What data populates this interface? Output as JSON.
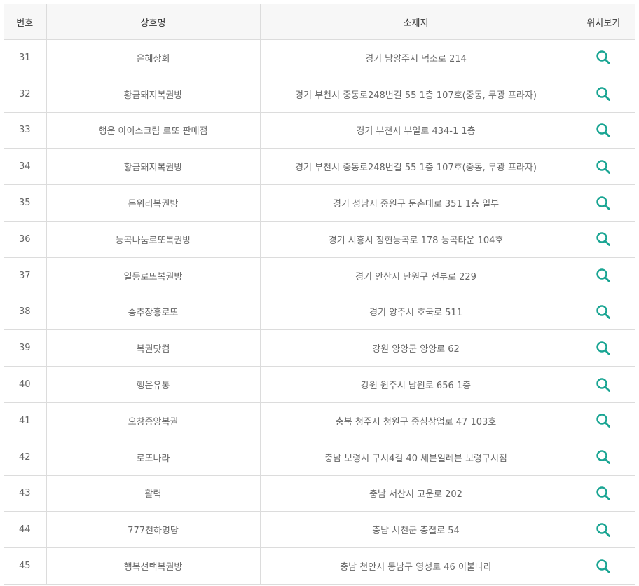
{
  "headers": [
    "번호",
    "상호명",
    "소재지",
    "위치보기"
  ],
  "accent_color": "#1aa593",
  "rows": [
    {
      "num": "31",
      "name": "은혜상회",
      "address": "경기 남양주시 덕소로 214"
    },
    {
      "num": "32",
      "name": "황금돼지복권방",
      "address": "경기 부천시 중동로248번길 55 1층 107호(중동, 무광 프라자)"
    },
    {
      "num": "33",
      "name": "행운 아이스크림 로또 판매점",
      "address": "경기 부천시 부일로 434-1 1층"
    },
    {
      "num": "34",
      "name": "황금돼지복권방",
      "address": "경기 부천시 중동로248번길 55 1층 107호(중동, 무광 프라자)"
    },
    {
      "num": "35",
      "name": "돈워리복권방",
      "address": "경기 성남시 중원구 둔촌대로 351 1층 일부"
    },
    {
      "num": "36",
      "name": "능곡나눔로또복권방",
      "address": "경기 시흥시 장현능곡로 178 능곡타운 104호"
    },
    {
      "num": "37",
      "name": "일등로또복권방",
      "address": "경기 안산시 단원구 선부로 229"
    },
    {
      "num": "38",
      "name": "송추장흥로또",
      "address": "경기 양주시 호국로 511"
    },
    {
      "num": "39",
      "name": "복권닷컴",
      "address": "강원 양양군 양양로 62"
    },
    {
      "num": "40",
      "name": "행운유통",
      "address": "강원 원주시 남원로 656 1층"
    },
    {
      "num": "41",
      "name": "오창중앙복권",
      "address": "충북 청주시 청원구 중심상업로 47 103호"
    },
    {
      "num": "42",
      "name": "로또나라",
      "address": "충남 보령시 구시4길 40 세븐일레븐 보령구시점"
    },
    {
      "num": "43",
      "name": "활력",
      "address": "충남 서산시 고운로 202"
    },
    {
      "num": "44",
      "name": "777천하명당",
      "address": "충남 서천군 충절로 54"
    },
    {
      "num": "45",
      "name": "행복선택복권방",
      "address": "충남 천안시 동남구 영성로 46 이불나라"
    }
  ]
}
